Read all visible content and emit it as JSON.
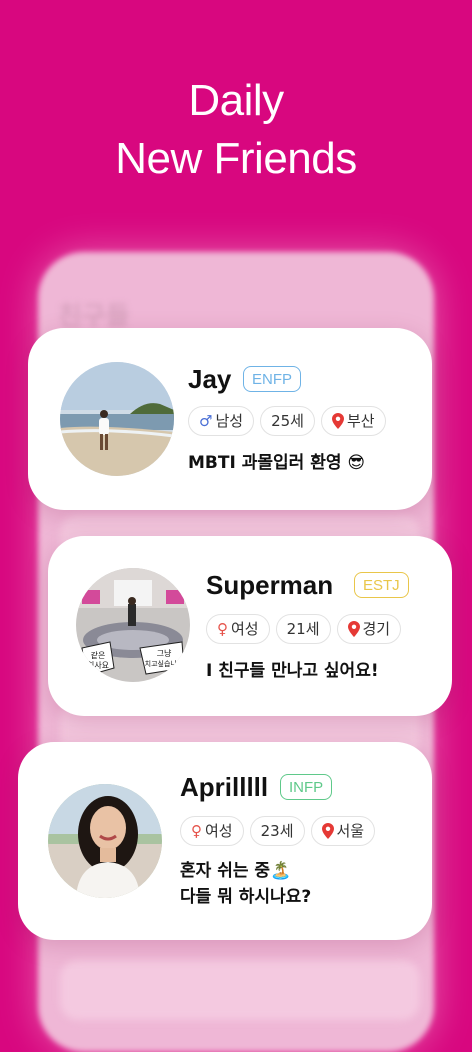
{
  "headline": {
    "line1": "Daily",
    "line2": "New Friends"
  },
  "backdrop": {
    "title": "친구들"
  },
  "profiles": [
    {
      "name": "Jay",
      "mbti": "ENFP",
      "mbti_color": "#6fb3e6",
      "gender_icon": "male-icon",
      "gender": "남성",
      "age": "25세",
      "location": "부산",
      "message": "MBTI 과몰입러 환영 😎"
    },
    {
      "name": "Superman",
      "mbti": "ESTJ",
      "mbti_color": "#e9c64a",
      "gender_icon": "female-icon",
      "gender": "여성",
      "age": "21세",
      "location": "경기",
      "message": "I 친구들 만나고 싶어요!",
      "avatar_caption_1": "같은\n회사요",
      "avatar_caption_2": "그냥\n치고싶습니다"
    },
    {
      "name": "Aprilllll",
      "mbti": "INFP",
      "mbti_color": "#5fc98a",
      "gender_icon": "female-icon",
      "gender": "여성",
      "age": "23세",
      "location": "서울",
      "message_line1": "혼자 쉬는 중🏝️",
      "message_line2": "다들 뭐 하시나요?"
    }
  ],
  "colors": {
    "background": "#d8077f",
    "male": "#4a6fd6",
    "female": "#e5534b",
    "location": "#e53935"
  }
}
